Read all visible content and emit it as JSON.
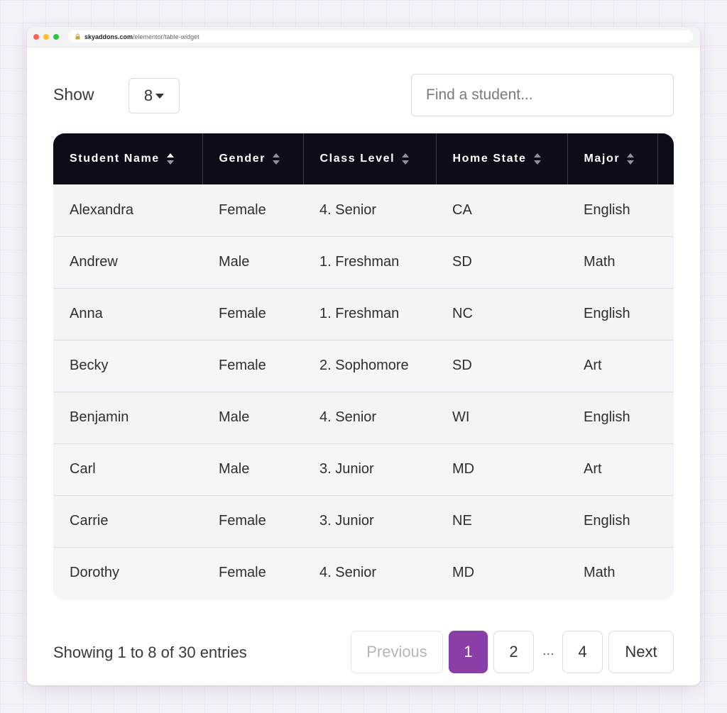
{
  "browser": {
    "url_domain": "skyaddons.com",
    "url_path": "/elementor/table-widget"
  },
  "controls": {
    "show_label": "Show",
    "show_value": "8",
    "search_placeholder": "Find a student..."
  },
  "table": {
    "columns": [
      "Student Name",
      "Gender",
      "Class Level",
      "Home State",
      "Major"
    ],
    "rows": [
      [
        "Alexandra",
        "Female",
        "4. Senior",
        "CA",
        "English"
      ],
      [
        "Andrew",
        "Male",
        "1. Freshman",
        "SD",
        "Math"
      ],
      [
        "Anna",
        "Female",
        "1. Freshman",
        "NC",
        "English"
      ],
      [
        "Becky",
        "Female",
        "2. Sophomore",
        "SD",
        "Art"
      ],
      [
        "Benjamin",
        "Male",
        "4. Senior",
        "WI",
        "English"
      ],
      [
        "Carl",
        "Male",
        "3. Junior",
        "MD",
        "Art"
      ],
      [
        "Carrie",
        "Female",
        "3. Junior",
        "NE",
        "English"
      ],
      [
        "Dorothy",
        "Female",
        "4. Senior",
        "MD",
        "Math"
      ]
    ]
  },
  "footer": {
    "info": "Showing 1 to 8 of 30 entries",
    "prev_label": "Previous",
    "pages": [
      "1",
      "2",
      "4"
    ],
    "ellipsis": "...",
    "next_label": "Next"
  },
  "colors": {
    "header_bg": "#0b0e18",
    "accent": "#8a3ea8"
  },
  "icons": [
    "lock-icon",
    "sort-icon",
    "caret-down-icon"
  ]
}
